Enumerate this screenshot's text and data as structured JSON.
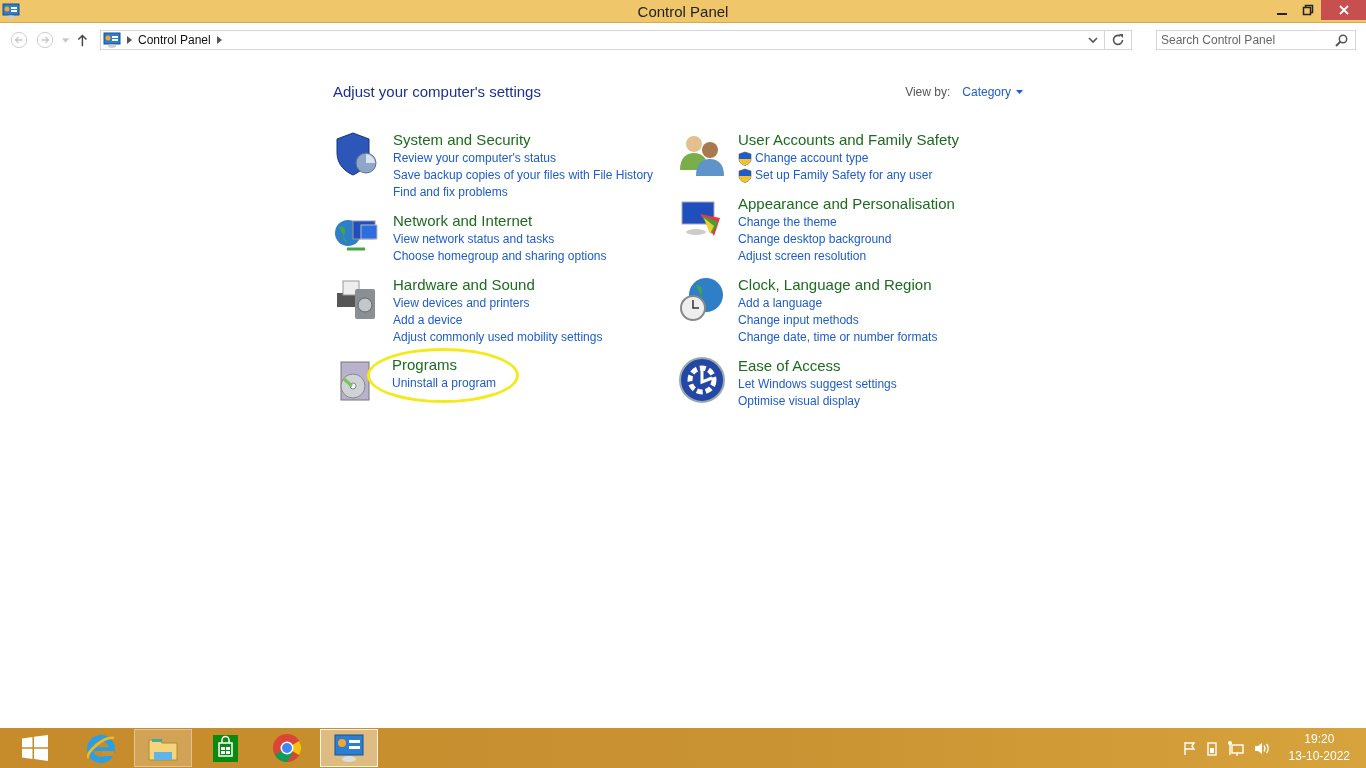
{
  "window": {
    "title": "Control Panel"
  },
  "address_bar": {
    "path": [
      "Control Panel"
    ]
  },
  "search": {
    "placeholder": "Search Control Panel"
  },
  "heading": "Adjust your computer's settings",
  "view_by": {
    "label": "View by:",
    "value": "Category"
  },
  "columns": [
    {
      "categories": [
        {
          "kind": "security",
          "title": "System and Security",
          "links": [
            {
              "text": "Review your computer's status",
              "shield": false
            },
            {
              "text": "Save backup copies of your files with File History",
              "shield": false
            },
            {
              "text": "Find and fix problems",
              "shield": false
            }
          ]
        },
        {
          "kind": "network",
          "title": "Network and Internet",
          "links": [
            {
              "text": "View network status and tasks",
              "shield": false
            },
            {
              "text": "Choose homegroup and sharing options",
              "shield": false
            }
          ]
        },
        {
          "kind": "hardware",
          "title": "Hardware and Sound",
          "links": [
            {
              "text": "View devices and printers",
              "shield": false
            },
            {
              "text": "Add a device",
              "shield": false
            },
            {
              "text": "Adjust commonly used mobility settings",
              "shield": false
            }
          ]
        },
        {
          "kind": "programs",
          "title": "Programs",
          "highlighted": true,
          "links": [
            {
              "text": "Uninstall a program",
              "shield": false
            }
          ]
        }
      ]
    },
    {
      "categories": [
        {
          "kind": "users",
          "title": "User Accounts and Family Safety",
          "links": [
            {
              "text": "Change account type",
              "shield": true
            },
            {
              "text": "Set up Family Safety for any user",
              "shield": true
            }
          ]
        },
        {
          "kind": "appearance",
          "title": "Appearance and Personalisation",
          "links": [
            {
              "text": "Change the theme",
              "shield": false
            },
            {
              "text": "Change desktop background",
              "shield": false
            },
            {
              "text": "Adjust screen resolution",
              "shield": false
            }
          ]
        },
        {
          "kind": "clock",
          "title": "Clock, Language and Region",
          "links": [
            {
              "text": "Add a language",
              "shield": false
            },
            {
              "text": "Change input methods",
              "shield": false
            },
            {
              "text": "Change date, time or number formats",
              "shield": false
            }
          ]
        },
        {
          "kind": "access",
          "title": "Ease of Access",
          "links": [
            {
              "text": "Let Windows suggest settings",
              "shield": false
            },
            {
              "text": "Optimise visual display",
              "shield": false
            }
          ]
        }
      ]
    }
  ],
  "taskbar": {
    "apps": [
      {
        "kind": "browser-e",
        "running": false,
        "selected": false
      },
      {
        "kind": "folder",
        "running": true,
        "selected": false
      },
      {
        "kind": "store",
        "running": false,
        "selected": false
      },
      {
        "kind": "chrome",
        "running": false,
        "selected": false
      },
      {
        "kind": "control",
        "running": true,
        "selected": true
      }
    ],
    "time": "19:20",
    "date": "13-10-2022"
  }
}
